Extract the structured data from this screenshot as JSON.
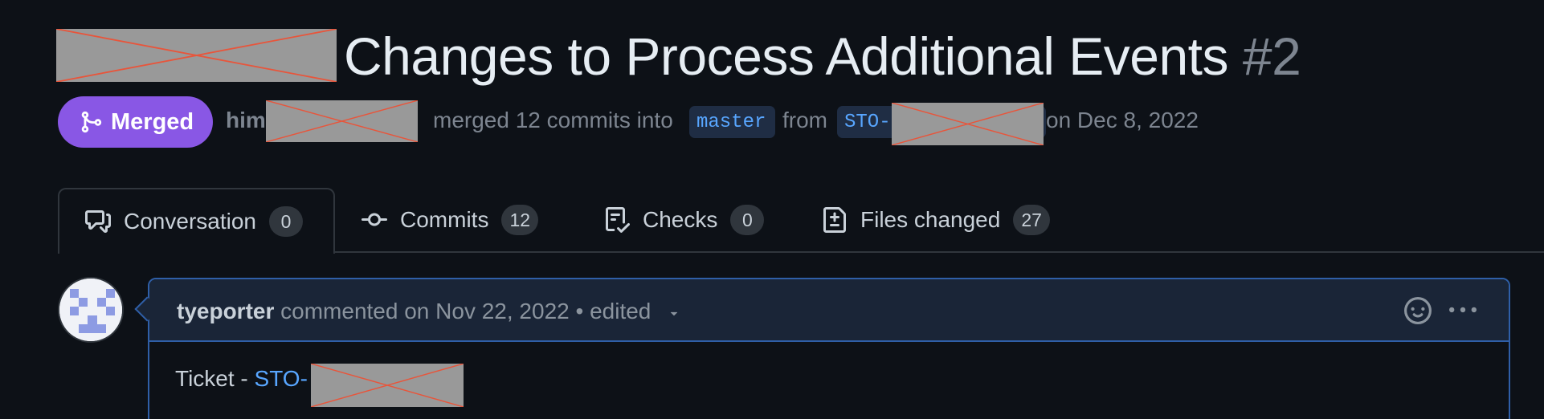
{
  "pr": {
    "title": "Changes to Process Additional Events",
    "number": "#2"
  },
  "status": {
    "badge_label": "Merged",
    "author_prefix": "him",
    "merged_text": "merged 12 commits into",
    "base_branch": "master",
    "from_text": "from",
    "head_branch_prefix": "STO-",
    "date_text": "on Dec 8, 2022"
  },
  "tabs": [
    {
      "label": "Conversation",
      "count": "0",
      "icon": "comment-discussion-icon"
    },
    {
      "label": "Commits",
      "count": "12",
      "icon": "git-commit-icon"
    },
    {
      "label": "Checks",
      "count": "0",
      "icon": "checklist-icon"
    },
    {
      "label": "Files changed",
      "count": "27",
      "icon": "file-diff-icon"
    }
  ],
  "comment": {
    "author": "tyeporter",
    "action": "commented on Nov 22, 2022",
    "separator": "•",
    "edited_label": "edited",
    "body_prefix": "Ticket - ",
    "body_link_prefix": "STO-"
  },
  "colors": {
    "background": "#0d1117",
    "merged": "#8957e5",
    "link": "#58a6ff",
    "comment_border": "#2f5fa8"
  }
}
